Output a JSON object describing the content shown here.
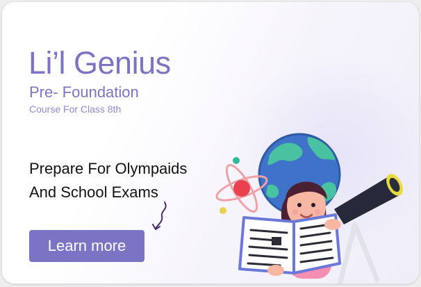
{
  "card": {
    "title": "Li’l Genius",
    "subtitle": "Pre- Foundation",
    "course": "Course For Class 8th",
    "tagline": [
      "Prepare For Olympaids",
      "And School Exams"
    ],
    "cta_label": "Learn more"
  },
  "colors": {
    "accent": "#7b73c4",
    "text": "#111111",
    "background": "#ffffff"
  },
  "illustration": {
    "icons": [
      "globe-icon",
      "atom-icon",
      "telescope-icon",
      "open-book-icon",
      "student-girl-icon"
    ]
  }
}
